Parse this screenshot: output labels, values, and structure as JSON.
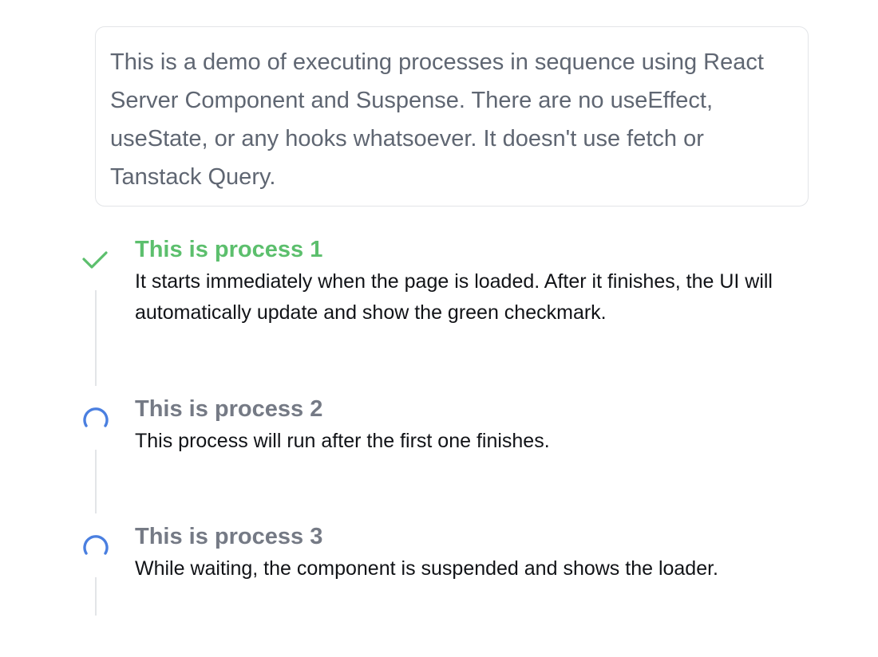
{
  "intro": {
    "text": "This is a demo of executing processes in sequence using React Server Component and Suspense. There are no useEffect, useState, or any hooks whatsoever. It doesn't use fetch or Tanstack Query."
  },
  "steps": [
    {
      "status": "done",
      "icon": "checkmark-icon",
      "title": "This is process 1",
      "description": "It starts immediately when the page is loaded. After it finishes, the UI will automatically update and show the green checkmark."
    },
    {
      "status": "loading",
      "icon": "spinner-icon",
      "title": "This is process 2",
      "description": "This process will run after the first one finishes."
    },
    {
      "status": "loading",
      "icon": "spinner-icon",
      "title": "This is process 3",
      "description": "While waiting, the component is suspended and shows the loader."
    }
  ],
  "colors": {
    "done": "#5cbf6d",
    "pending_title": "#757a85",
    "spinner": "#4a7fe0",
    "connector": "#e3e5e8",
    "intro_text": "#5f6672"
  }
}
